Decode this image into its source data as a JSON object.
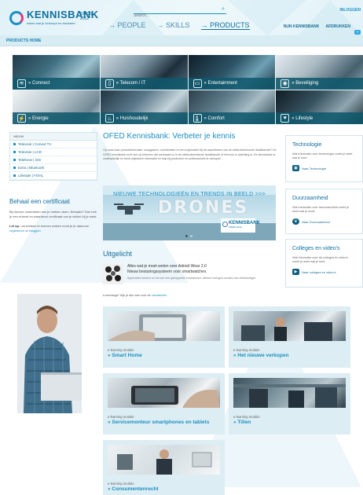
{
  "header": {
    "brand": "KENNISBANK",
    "since": "SINDS 2012",
    "tagline": "weten wat je verkoopt en adviseert",
    "search_placeholder": "Search...",
    "login_label": "INLOGGEN",
    "main_nav": [
      {
        "label": "→ PEOPLE",
        "active": false
      },
      {
        "label": "→ SKILLS",
        "active": false
      },
      {
        "label": "→ PRODUCTS",
        "active": true
      }
    ],
    "sub_nav": [
      "NUN KENNISBANK",
      "AFDRUKKEN"
    ]
  },
  "breadcrumb": "PRODUCTS HOME",
  "categories": [
    {
      "label": "» Connect",
      "icon": "wifi-icon",
      "glyph": "≋"
    },
    {
      "label": "» Telecom / IT",
      "icon": "phone-icon",
      "glyph": "▯"
    },
    {
      "label": "» Entertainment",
      "icon": "monitor-icon",
      "glyph": "▭"
    },
    {
      "label": "» Beveiliging",
      "icon": "camera-icon",
      "glyph": "◉"
    },
    {
      "label": "» Energie",
      "icon": "plug-icon",
      "glyph": "⚡"
    },
    {
      "label": "» Huishoudelijk",
      "icon": "kettle-icon",
      "glyph": "♨"
    },
    {
      "label": "» Comfort",
      "icon": "thermometer-icon",
      "glyph": "🌡"
    },
    {
      "label": "» Lifestyle",
      "icon": "heartbeat-icon",
      "glyph": "♥"
    }
  ],
  "nieuw": {
    "heading": "NIEUW",
    "items": [
      "Televisie | Curved TV",
      "Televisie | LCD",
      "Telefonie | iOS",
      "Extra | Bluetooth",
      "Lifestyle | FOHL"
    ]
  },
  "certificate": {
    "title": "Behaal een certificaat",
    "text": "Bij diverse onderdelen kun je toetsen doen. Behaald? Dan heb je een erkend en waardevol certificaat van je winkel bij je werk.",
    "note_bold": "Let op:",
    "note_text": "om toetsen te kunnen maken moet je je daarvoor",
    "link_register": "registreren",
    "note_or": "of",
    "link_login": "inloggen"
  },
  "main": {
    "title": "OFED Kennisbank: Verbeter je kennis",
    "intro": "Op zoek naar productinformatie, koopgidsen, voorbeelden of een hulpmiddel bij het assortiment van de elektrotechnische detailhandel? De OFED kennisbank richt zich op iedereen die werkzaam is in de elektrotechnische detailhandel of hiervoor in opleiding is. De kennisbank is onafhankelijk en biedt objectieve informatie en hulp bij producten en professioneel te verkopen.",
    "banner_heading": "NIEUWE TECHNOLOGIEËN EN TRENDS IN BEELD >>>",
    "banner_word": "DRONES",
    "banner_logo": "KENNISBANK",
    "banner_logo_since": "SINDS 2012",
    "featured_title": "Uitgelicht",
    "featured_headline_1": "Alles wat je moet weten over Adroid Wear 2.0",
    "featured_headline_2": "Nieuw besturingssysteem voor smartwatches",
    "featured_desc": "Applicaties werken nu los van een gekoppelde smartphone; slimme horloges worden dus zelfstandiger.",
    "elearn_prefix": "e-learnings? Kijk je dan aan voor de",
    "elearn_link": "nieuwsbrief",
    "elearn_suffix": "."
  },
  "modules": [
    {
      "type": "e-learning module",
      "name": "» Smart Home"
    },
    {
      "type": "e-learning module",
      "name": "» Het nieuwe verkopen"
    },
    {
      "type": "e-learning module",
      "name": "» Servicemonteur smartphones en tablets"
    },
    {
      "type": "e-learning module",
      "name": "» Tillen"
    },
    {
      "type": "e-learning module",
      "name": "» Consumentenrecht"
    }
  ],
  "right": [
    {
      "title": "Technologie",
      "desc": "Wat informatie over technologie zoekt je weet wat je kunt.",
      "link": "Naar Technologie",
      "icon": "chip-icon"
    },
    {
      "title": "Duurzaamheid",
      "desc": "Wat informatie over duurzaamheid zoekt je weet wat je moet.",
      "link": "Naar Duurzaamheid",
      "icon": "leaf-icon"
    },
    {
      "title": "Colleges en video's",
      "desc": "Wat informatie over de colleges en video's zoekt je weet wat je kunt.",
      "link": "Naar colleges en video's",
      "icon": "video-icon"
    }
  ],
  "colors": {
    "accent": "#1a8fc4",
    "dark_accent": "#0f6f9e",
    "category_bar": "#10586c",
    "module_bg": "#dcedf3"
  }
}
